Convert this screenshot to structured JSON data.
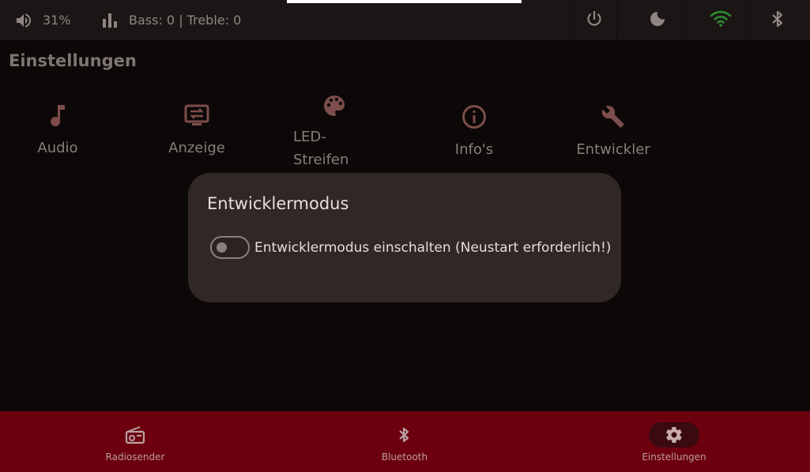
{
  "status": {
    "volume_icon": "volume-icon",
    "volume": "31%",
    "eq_icon": "equalizer-icon",
    "bass_treble": "Bass: 0 | Treble: 0",
    "power_icon": "power-icon",
    "moon_icon": "moon-icon",
    "wifi_icon": "wifi-icon",
    "bluetooth_icon": "bluetooth-icon",
    "wifi_color": "#2e8b2e"
  },
  "page": {
    "title": "Einstellungen"
  },
  "categories": [
    {
      "label": "Audio",
      "icon": "music-note-icon"
    },
    {
      "label": "Anzeige",
      "icon": "display-settings-icon"
    },
    {
      "label": "LED-Streifen",
      "label_line1": "LED-",
      "label_line2": "Streifen",
      "icon": "palette-icon"
    },
    {
      "label": "Info's",
      "icon": "info-icon"
    },
    {
      "label": "Entwickler",
      "icon": "wrench-icon"
    }
  ],
  "dialog": {
    "title": "Entwicklermodus",
    "toggle_label": "Entwicklermodus einschalten (Neustart erforderlich!)",
    "toggle_on": false
  },
  "nav": {
    "items": [
      {
        "label": "Radiosender",
        "icon": "radio-icon",
        "active": false
      },
      {
        "label": "Bluetooth",
        "icon": "bluetooth-icon",
        "active": false
      },
      {
        "label": "Einstellungen",
        "icon": "gear-icon",
        "active": true
      }
    ],
    "background": "#6c000e"
  }
}
